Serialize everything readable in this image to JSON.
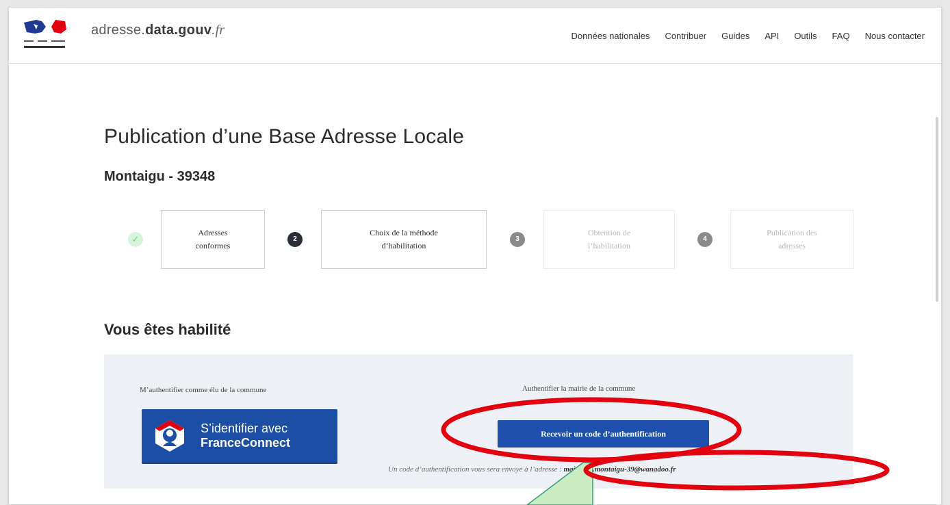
{
  "header": {
    "site_name_part1": "adresse.",
    "site_name_part2": "data.gouv",
    "site_name_part3": ".fr",
    "nav": [
      "Données nationales",
      "Contribuer",
      "Guides",
      "API",
      "Outils",
      "FAQ",
      "Nous contacter"
    ]
  },
  "page": {
    "title": "Publication d’une Base Adresse Locale",
    "commune": "Montaigu - 39348"
  },
  "steps": [
    {
      "number": "✓",
      "label_line1": "Adresses",
      "label_line2": "conformes",
      "state": "done"
    },
    {
      "number": "2",
      "label_line1": "Choix de la méthode",
      "label_line2": "d’habilitation",
      "state": "active"
    },
    {
      "number": "3",
      "label_line1": "Obtention de",
      "label_line2": "l’habilitation",
      "state": "todo"
    },
    {
      "number": "4",
      "label_line1": "Publication des",
      "label_line2": "adresses",
      "state": "todo"
    }
  ],
  "auth": {
    "section_title": "Vous êtes habilité",
    "elu_label": "M’authentifier comme élu de la commune",
    "franceconnect_line1": "S’identifier avec",
    "franceconnect_line2": "FranceConnect",
    "mairie_label": "Authentifier la mairie de la commune",
    "code_button": "Recevoir un code d’authentification",
    "code_note": "Un code d’authentification vous sera envoyé à l’adresse : ",
    "email": "mairie.de.montaigu-39@wanadoo.fr"
  },
  "colors": {
    "primary_blue": "#1e4fad",
    "annotation_red": "#e3000f",
    "callout_green": "#c9ecc2"
  }
}
